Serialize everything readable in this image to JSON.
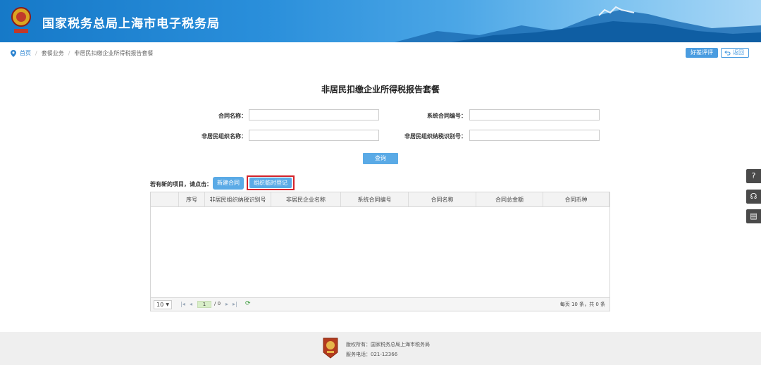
{
  "header": {
    "title": "国家税务总局上海市电子税务局"
  },
  "breadcrumb": {
    "home": "首页",
    "level2": "套餐业务",
    "level3": "非居民扣缴企业所得税报告套餐"
  },
  "top_buttons": {
    "review": "好差评评价",
    "back": "返回"
  },
  "page_title": "非居民扣缴企业所得税报告套餐",
  "form": {
    "contract_name_label": "合同名称：",
    "system_contract_no_label": "系统合同编号：",
    "nonresident_org_name_label": "非居民组织名称：",
    "nonresident_taxpayer_id_label": "非居民组织纳税识别号：",
    "contract_name_value": "",
    "system_contract_no_value": "",
    "nonresident_org_name_value": "",
    "nonresident_taxpayer_id_value": "",
    "query_button": "查询"
  },
  "actions": {
    "hint": "若有新的项目，请点击：",
    "new_contract": "新建合同",
    "temp_register": "组织临时登记"
  },
  "table": {
    "columns": [
      "序号",
      "非居民组织纳税识别号",
      "非居民企业名称",
      "系统合同编号",
      "合同名称",
      "合同总金额",
      "合同币种"
    ],
    "rows": []
  },
  "pager": {
    "page_size": "10",
    "current_page": "1",
    "total_pages": "/ 0",
    "info": "每页 10 条，共 0 条"
  },
  "footer": {
    "copyright": "版权所有：国家税务总局上海市税务局",
    "service_phone": "服务电话：021-12366"
  },
  "side_tools": [
    "help-icon",
    "headset-icon",
    "book-icon"
  ],
  "colors": {
    "header_blue": "#1679c8",
    "button_blue": "#5aaae6",
    "highlight_red": "#d4232a"
  }
}
